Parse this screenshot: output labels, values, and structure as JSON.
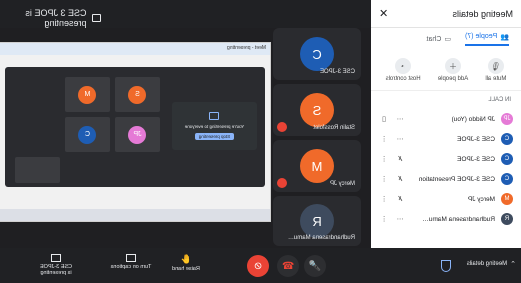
{
  "top": {
    "presenting": "CSE 3 JPOE is presenting"
  },
  "panel": {
    "title": "Meeting details",
    "tabs": [
      "People (7)",
      "Chat"
    ],
    "actions": [
      "Mute all",
      "Add people",
      "Host controls"
    ],
    "in_call_label": "IN CALL",
    "people": [
      {
        "name": "JP Niddo (You)",
        "initial": "JP",
        "color": "#e57ad6"
      },
      {
        "name": "CSE 3-JPOE",
        "initial": "C",
        "color": "#1e5db4"
      },
      {
        "name": "CSE 3-JPOE",
        "initial": "C",
        "color": "#1e5db4"
      },
      {
        "name": "CSE 3-JPOE Presentation",
        "initial": "C",
        "color": "#1e5db4"
      },
      {
        "name": "Mercy JP",
        "initial": "M",
        "color": "#f06a2a"
      },
      {
        "name": "Rudhandrasena Mamu…",
        "initial": "R",
        "color": "#3e4b5e"
      }
    ]
  },
  "tiles": [
    {
      "label": "CSE 3-JPOE",
      "initial": "C",
      "color": "#1e5db4"
    },
    {
      "label": "Stalin Rossfolet",
      "initial": "S",
      "color": "#f06a2a"
    },
    {
      "label": "Mercy JP",
      "initial": "M",
      "color": "#f06a2a"
    },
    {
      "label": "Rudhandrasena Mamu…",
      "initial": "R",
      "color": "#3e4b5e"
    }
  ],
  "presentation": {
    "window_title": "Meet - presenting",
    "center_text": "You're presenting to everyone",
    "button": "Stop presenting",
    "mini_avatars": [
      "C",
      "JP",
      "M",
      "S"
    ]
  },
  "bottom": {
    "left_label_1": "CSE 3-JPOE",
    "left_label_2": "is presenting",
    "turn_captions": "Turn on captions",
    "raise_hand": "Raise hand",
    "meeting_details": "Meeting details"
  }
}
